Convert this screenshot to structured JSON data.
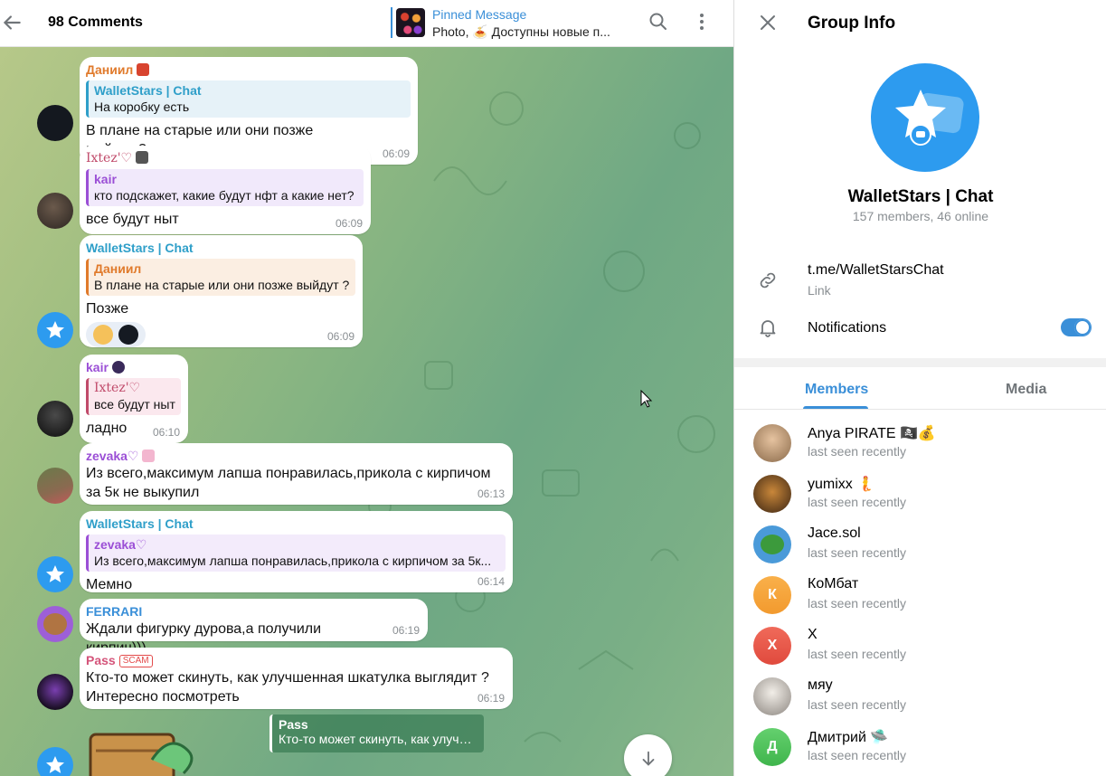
{
  "header": {
    "title": "98 Comments",
    "pinned_label": "Pinned Message",
    "pinned_text": "Photo, 🍝 Доступны новые п..."
  },
  "messages": [
    {
      "sender": "Даниил",
      "reply_name": "WalletStars | Chat",
      "reply_text": "На коробку есть",
      "text": "В плане на старые или они позже выйдут ?",
      "time": "06:09"
    },
    {
      "sender": "Ixtez'♡",
      "reply_name": "kair",
      "reply_text": "кто подскажет, какие будут нфт а какие нет?",
      "text": "все будут ныт",
      "time": "06:09"
    },
    {
      "sender": "WalletStars | Chat",
      "reply_name": "Даниил",
      "reply_text": "В плане на старые или они позже выйдут ?",
      "text": "Позже",
      "time": "06:09"
    },
    {
      "sender": "kair",
      "reply_name": "Ixtez'♡",
      "reply_text": "все будут ныт",
      "text": "ладно",
      "time": "06:10"
    },
    {
      "sender": "zevaka♡",
      "text_line1": "Из всего,максимум лапша понравилась,прикола с кирпичом",
      "text_line2": "за 5к не выкупил",
      "time": "06:13"
    },
    {
      "sender": "WalletStars | Chat",
      "reply_name": "zevaka♡",
      "reply_text": "Из всего,максимум лапша понравилась,прикола с кирпичом за 5к...",
      "text": "Мемно",
      "time": "06:14"
    },
    {
      "sender": "FERRARI",
      "text": "Ждали фигурку дурова,а получили кирпич)))",
      "time": "06:19"
    },
    {
      "sender": "Pass",
      "badge": "SCAM",
      "text_line1": "Кто-то может скинуть, как улучшенная шкатулка выглядит ?",
      "text_line2": "Интересно посмотреть",
      "time": "06:19"
    }
  ],
  "forward_card": {
    "name": "Pass",
    "text": "Кто-то может скинуть, как улучшенная шкатулка выглядит ?"
  },
  "info": {
    "title": "Group Info",
    "group_name": "WalletStars | Chat",
    "group_sub": "157 members, 46 online",
    "link": "t.me/WalletStarsChat",
    "link_label": "Link",
    "notifications_label": "Notifications",
    "notifications_on": true,
    "tabs": [
      "Members",
      "Media"
    ],
    "members": [
      {
        "name": "Anya PIRATE 🏴‍☠️💰",
        "status": "last seen recently",
        "initial": "",
        "color": "#c9a27a"
      },
      {
        "name": "yumixx 🧜",
        "status": "last seen recently",
        "initial": "",
        "color": "#8a5a2b"
      },
      {
        "name": "Jace.sol",
        "status": "last seen recently",
        "initial": "",
        "color": "#4a9ad9"
      },
      {
        "name": "КоМбат",
        "status": "last seen recently",
        "initial": "К",
        "color": "#f5a23b"
      },
      {
        "name": "X",
        "status": "last seen recently",
        "initial": "X",
        "color": "#e8574a"
      },
      {
        "name": "мяу",
        "status": "last seen recently",
        "initial": "",
        "color": "#c8c3bd"
      },
      {
        "name": "Дмитрий 🛸",
        "status": "last seen recently",
        "initial": "Д",
        "color": "#4cbf5a"
      }
    ]
  },
  "colors": {
    "accent": "#3a8fd8",
    "danil": "#e07a2b",
    "purple": "#9b4fd6",
    "walletstars": "#2f9fc9",
    "ferrari": "#3a8fd8",
    "pass": "#d4547a"
  }
}
